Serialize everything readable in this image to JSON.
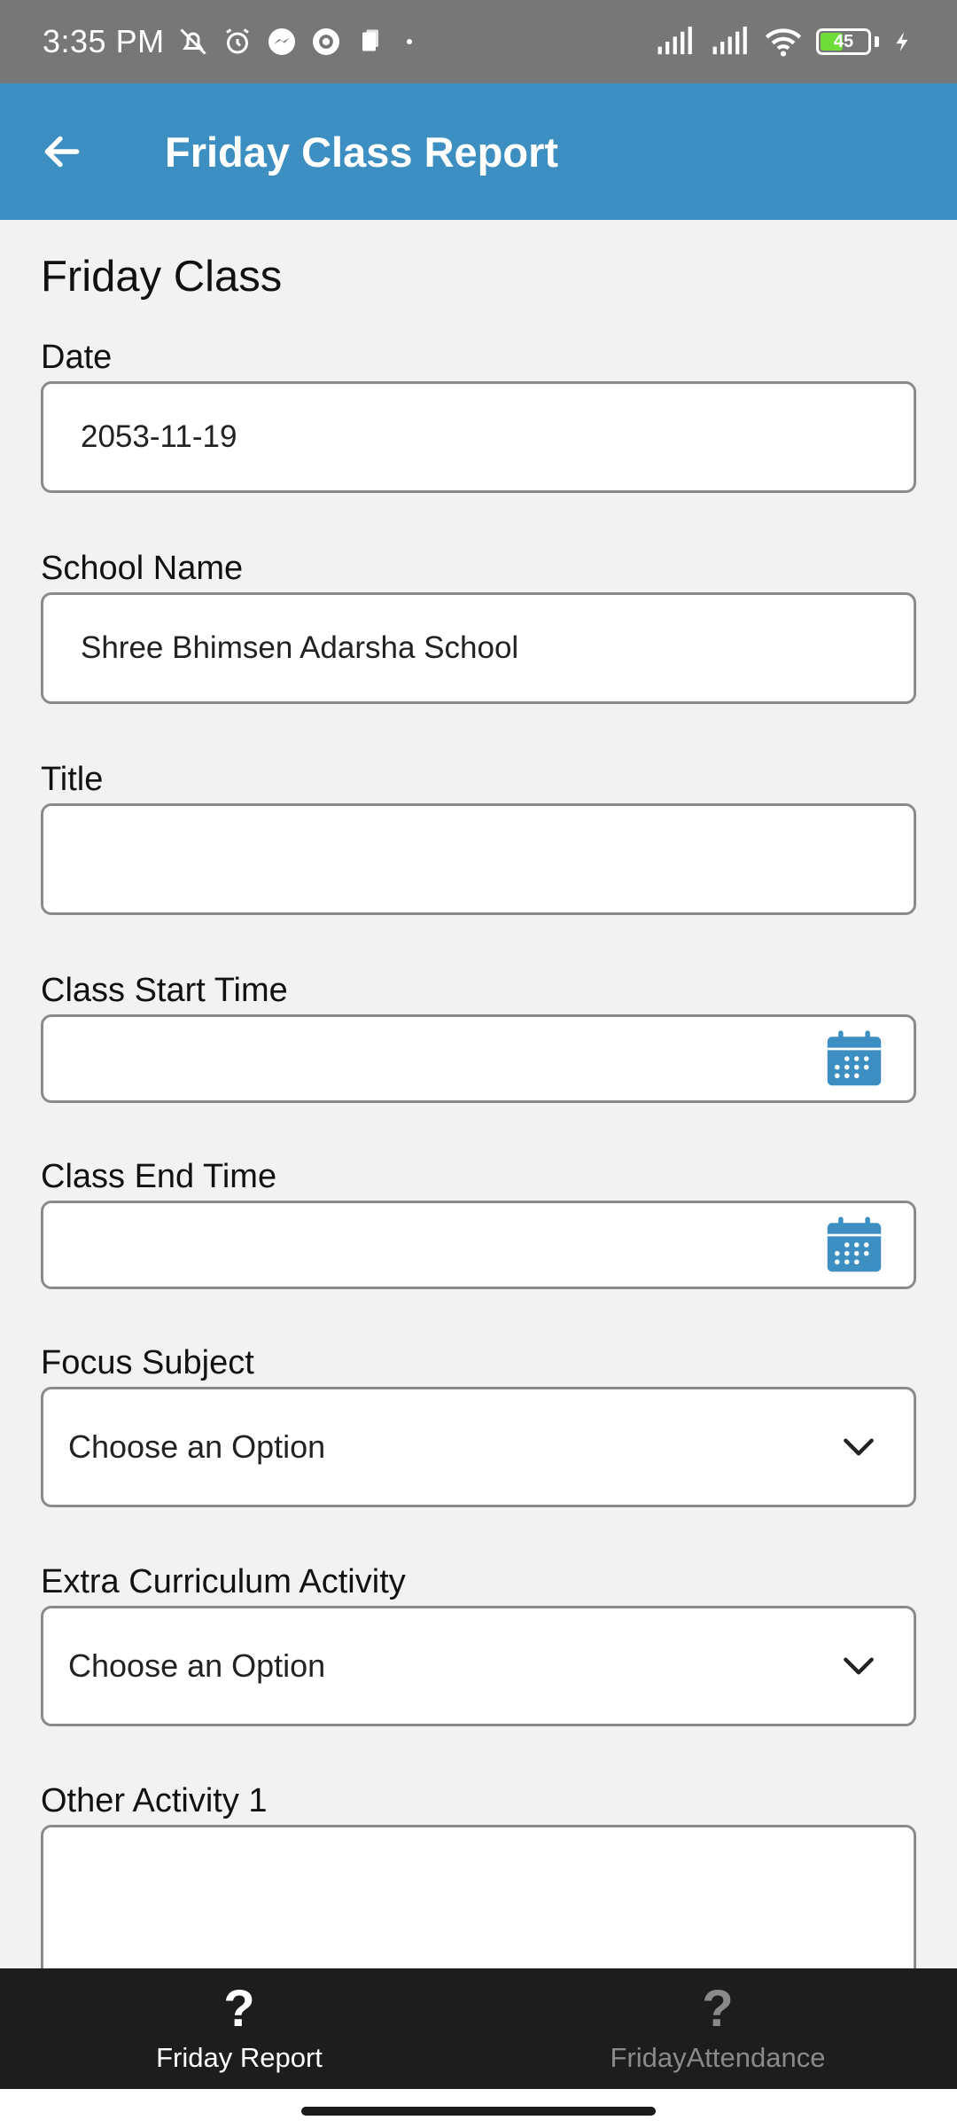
{
  "status_bar": {
    "time": "3:35 PM",
    "battery_level": "45",
    "battery_color": "#6fdc3a",
    "icons_left": [
      "mute-icon",
      "alarm-icon",
      "messenger-icon",
      "sync-icon",
      "clipboard-icon",
      "dot-icon"
    ],
    "icons_right": [
      "signal-icon",
      "signal-icon",
      "wifi-icon",
      "battery-icon",
      "charging-icon"
    ]
  },
  "app_bar": {
    "title": "Friday Class Report",
    "back_icon": "arrow-left-icon",
    "color": "#3d8fc1"
  },
  "form": {
    "section_title": "Friday Class",
    "date": {
      "label": "Date",
      "value": "2053-11-19"
    },
    "school_name": {
      "label": "School Name",
      "value": "Shree Bhimsen Adarsha School"
    },
    "title": {
      "label": "Title",
      "value": ""
    },
    "class_start_time": {
      "label": "Class Start Time",
      "value": "",
      "icon": "calendar-icon"
    },
    "class_end_time": {
      "label": "Class End Time",
      "value": "",
      "icon": "calendar-icon"
    },
    "focus_subject": {
      "label": "Focus Subject",
      "value": "Choose an Option"
    },
    "extra_curriculum_activity": {
      "label": "Extra Curriculum Activity",
      "value": "Choose an Option"
    },
    "other_activity_1": {
      "label": "Other Activity 1",
      "value": ""
    }
  },
  "bottom_nav": {
    "items": [
      {
        "label": "Friday Report",
        "icon": "?",
        "active": true
      },
      {
        "label": "FridayAttendance",
        "icon": "?",
        "active": false
      }
    ]
  }
}
